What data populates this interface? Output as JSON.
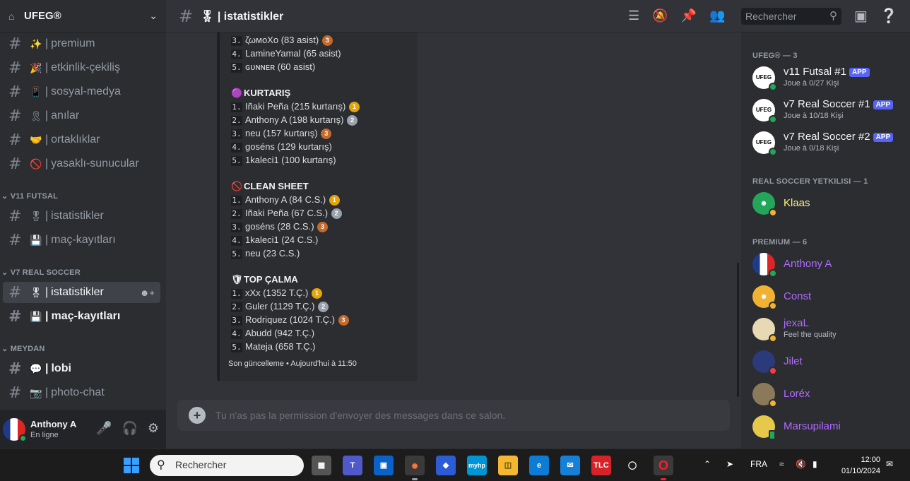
{
  "guild": {
    "name": "UFEG®"
  },
  "channels": [
    {
      "emoji": "✨",
      "name": "premium"
    },
    {
      "emoji": "🎉",
      "name": "etkinlik-çekiliş"
    },
    {
      "emoji": "📱",
      "name": "sosyal-medya"
    },
    {
      "emoji": "🎗",
      "name": "anılar"
    },
    {
      "emoji": "🤝",
      "name": "ortaklıklar"
    },
    {
      "emoji": "🚫",
      "name": "yasaklı-sunucular"
    }
  ],
  "categories": {
    "futsal": "V11 FUTSAL",
    "soccer": "V7 REAL SOCCER",
    "meydan": "MEYDAN"
  },
  "futsal_channels": [
    {
      "emoji": "🎖",
      "name": "istatistikler"
    },
    {
      "emoji": "💾",
      "name": "maç-kayıtları"
    }
  ],
  "soccer_channels": [
    {
      "emoji": "🎖",
      "name": "istatistikler"
    },
    {
      "emoji": "💾",
      "name": "maç-kayıtları"
    }
  ],
  "meydan_channels": [
    {
      "emoji": "💬",
      "name": "lobi"
    },
    {
      "emoji": "📷",
      "name": "photo-chat"
    }
  ],
  "user": {
    "name": "Anthony A",
    "status": "En ligne"
  },
  "header": {
    "title": "istatistikler",
    "title_emoji": "🎖",
    "search_placeholder": "Rechercher"
  },
  "embed": {
    "asist_rows": [
      {
        "n": "3.",
        "text": "ζωмοΧο (83 asist)",
        "medal": "3"
      },
      {
        "n": "4.",
        "text": "LamineYamal (65 asist)",
        "medal": ""
      },
      {
        "n": "5.",
        "text": "ɢᴜɴɴᴇʀ (60 asist)",
        "medal": ""
      }
    ],
    "sections": [
      {
        "title": "KURTARIŞ",
        "icon": "🟣",
        "rows": [
          {
            "n": "1.",
            "text": "Iñaki Peña (215 kurtarış)",
            "medal": "1"
          },
          {
            "n": "2.",
            "text": "Anthony A (198 kurtarış)",
            "medal": "2"
          },
          {
            "n": "3.",
            "text": "neu (157 kurtarış)",
            "medal": "3"
          },
          {
            "n": "4.",
            "text": "goséns (129 kurtarış)",
            "medal": ""
          },
          {
            "n": "5.",
            "text": "1kaleci1 (100 kurtarış)",
            "medal": ""
          }
        ]
      },
      {
        "title": "CLEAN SHEET",
        "icon": "🚫",
        "rows": [
          {
            "n": "1.",
            "text": "Anthony A (84 C.S.)",
            "medal": "1"
          },
          {
            "n": "2.",
            "text": "Iñaki Peña (67 C.S.)",
            "medal": "2"
          },
          {
            "n": "3.",
            "text": "goséns (28 C.S.)",
            "medal": "3"
          },
          {
            "n": "4.",
            "text": "1kaleci1 (24 C.S.)",
            "medal": ""
          },
          {
            "n": "5.",
            "text": "neu (23 C.S.)",
            "medal": ""
          }
        ]
      },
      {
        "title": "TOP ÇALMA",
        "icon": "🛡",
        "rows": [
          {
            "n": "1.",
            "text": "xXx (1352 T.Ç.)",
            "medal": "1"
          },
          {
            "n": "2.",
            "text": "Guler (1129 T.Ç.)",
            "medal": "2"
          },
          {
            "n": "3.",
            "text": "Rodriquez (1024 T.Ç.)",
            "medal": "3"
          },
          {
            "n": "4.",
            "text": "Abudd (942 T.Ç.)",
            "medal": ""
          },
          {
            "n": "5.",
            "text": "Mateja (658 T.Ç.)",
            "medal": ""
          }
        ]
      }
    ],
    "footer": "Son güncelleme • Aujourd'hui à 11:50"
  },
  "composer": {
    "placeholder": "Tu n'as pas la permission d'envoyer des messages dans ce salon."
  },
  "members": {
    "groups": [
      {
        "label": "UFEG® — 3",
        "items": [
          {
            "name": "v11 Futsal #1",
            "badge": "APP",
            "sub": "Joue à 0/27 Kişi",
            "status": "on",
            "color": "white",
            "avatar": "UFEG"
          },
          {
            "name": "v7 Real Soccer #1",
            "badge": "APP",
            "sub": "Joue à 10/18 Kişi",
            "status": "on",
            "color": "white",
            "avatar": "UFEG"
          },
          {
            "name": "v7 Real Soccer #2",
            "badge": "APP",
            "sub": "Joue à 0/18 Kişi",
            "status": "on",
            "color": "white",
            "avatar": "UFEG"
          }
        ]
      },
      {
        "label": "REAL SOCCER YETKILISI — 1",
        "items": [
          {
            "name": "Klaas",
            "badge": "",
            "sub": "",
            "status": "idle",
            "color": "yellow",
            "avatar": ""
          }
        ]
      },
      {
        "label": "PREMIUM — 6",
        "items": [
          {
            "name": "Anthony A",
            "badge": "",
            "sub": "",
            "status": "on",
            "color": "purple",
            "avatar": ""
          },
          {
            "name": "Const",
            "badge": "",
            "sub": "",
            "status": "idle",
            "color": "purple",
            "avatar": ""
          },
          {
            "name": "jexaL",
            "badge": "",
            "sub": "Feel the quality",
            "status": "idle",
            "color": "purple",
            "avatar": ""
          },
          {
            "name": "Jilet",
            "badge": "",
            "sub": "",
            "status": "dnd",
            "color": "purple",
            "avatar": ""
          },
          {
            "name": "Loréx",
            "badge": "",
            "sub": "",
            "status": "idle",
            "color": "purple",
            "avatar": ""
          },
          {
            "name": "Marsupilami",
            "badge": "",
            "sub": "",
            "status": "mob",
            "color": "purple",
            "avatar": ""
          }
        ]
      }
    ]
  },
  "taskbar": {
    "search_placeholder": "Rechercher",
    "lang": "FRA",
    "time": "12:00",
    "date": "01/10/2024"
  }
}
